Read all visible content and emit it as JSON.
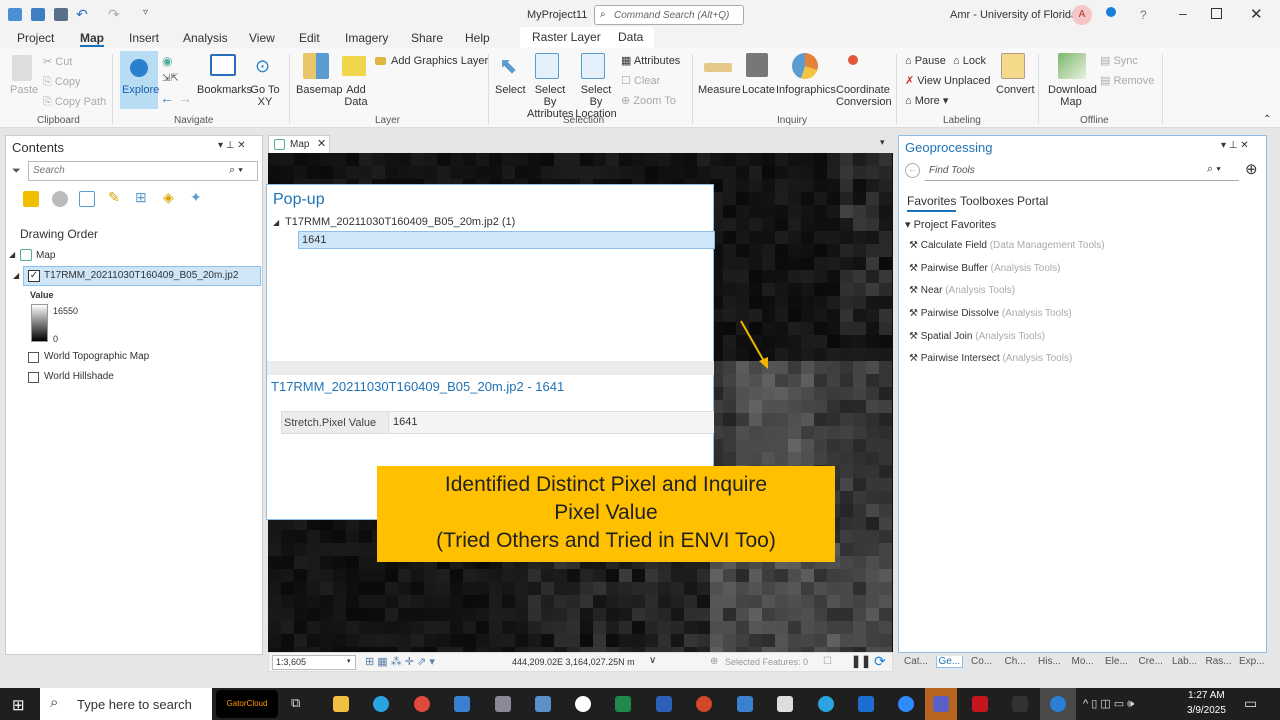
{
  "titlebar": {
    "project": "MyProject11",
    "command_search": "Command Search (Alt+Q)",
    "user": "Amr - University of Florida",
    "avatar_letter": "A",
    "help": "?"
  },
  "tabs": [
    "Project",
    "Map",
    "Insert",
    "Analysis",
    "View",
    "Edit",
    "Imagery",
    "Share",
    "Help"
  ],
  "context_tabs": [
    "Raster Layer",
    "Data"
  ],
  "ribbon": {
    "clipboard": {
      "label": "Clipboard",
      "paste": "Paste",
      "cut": "Cut",
      "copy": "Copy",
      "copy_path": "Copy Path"
    },
    "navigate": {
      "label": "Navigate",
      "explore": "Explore",
      "bookmarks": "Bookmarks",
      "go_to_xy": "Go To XY"
    },
    "layer": {
      "label": "Layer",
      "basemap": "Basemap",
      "add_data": "Add Data",
      "add_graphics_layer": "Add Graphics Layer"
    },
    "selection": {
      "label": "Selection",
      "select": "Select",
      "select_by_attributes": "Select By Attributes",
      "select_by_location": "Select By Location",
      "attributes": "Attributes",
      "clear": "Clear",
      "zoom_to": "Zoom To"
    },
    "inquiry": {
      "label": "Inquiry",
      "measure": "Measure",
      "locate": "Locate",
      "infographics": "Infographics",
      "coordinate_conversion": "Coordinate Conversion"
    },
    "labeling": {
      "label": "Labeling",
      "pause": "Pause",
      "lock": "Lock",
      "view_unplaced": "View Unplaced",
      "more": "More",
      "convert": "Convert"
    },
    "offline": {
      "label": "Offline",
      "download_map": "Download Map",
      "sync": "Sync",
      "remove": "Remove"
    }
  },
  "contents": {
    "title": "Contents",
    "search_placeholder": "Search",
    "drawing_order": "Drawing Order",
    "map": "Map",
    "layer": "T17RMM_20211030T160409_B05_20m.jp2",
    "value_label": "Value",
    "max": "16550",
    "min": "0",
    "layers": [
      "World Topographic Map",
      "World Hillshade"
    ]
  },
  "map_tab": "Map",
  "popup": {
    "title": "Pop-up",
    "tree_item": "T17RMM_20211030T160409_B05_20m.jp2 (1)",
    "selected": "1641",
    "detail_title": "T17RMM_20211030T160409_B05_20m.jp2 - 1641",
    "field": "Stretch.Pixel Value",
    "value": "1641"
  },
  "annotation": {
    "line1": "Identified Distinct Pixel and Inquire Pixel Value",
    "line2": "(Tried Others and Tried in ENVI Too)",
    "color": "#FFC000"
  },
  "statusbar": {
    "scale": "1:3,605",
    "coords": "444,209.02E 3,164,027.25N m",
    "selected": "Selected Features: 0"
  },
  "geoprocessing": {
    "title": "Geoprocessing",
    "search_placeholder": "Find Tools",
    "tabs": [
      "Favorites",
      "Toolboxes",
      "Portal"
    ],
    "section": "Project Favorites",
    "tools": [
      {
        "name": "Calculate Field",
        "box": "(Data Management Tools)"
      },
      {
        "name": "Pairwise Buffer",
        "box": "(Analysis Tools)"
      },
      {
        "name": "Near",
        "box": "(Analysis Tools)"
      },
      {
        "name": "Pairwise Dissolve",
        "box": "(Analysis Tools)"
      },
      {
        "name": "Spatial Join",
        "box": "(Analysis Tools)"
      },
      {
        "name": "Pairwise Intersect",
        "box": "(Analysis Tools)"
      }
    ],
    "bottom_tabs": [
      "Cat...",
      "Ge...",
      "Co...",
      "Ch...",
      "His...",
      "Mo...",
      "Ele...",
      "Cre...",
      "Lab...",
      "Ras...",
      "Exp..."
    ]
  },
  "taskbar": {
    "search": "Type here to search",
    "brand": "GatorCloud",
    "time": "1:27 AM",
    "date": "3/9/2025"
  }
}
